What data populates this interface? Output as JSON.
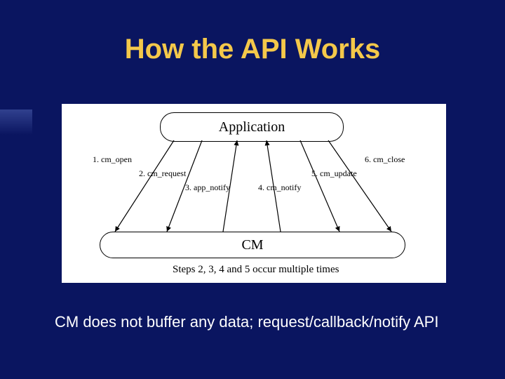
{
  "title": "How the API Works",
  "diagram": {
    "box_top": "Application",
    "box_bottom": "CM",
    "calls": {
      "c1": "1. cm_open",
      "c2": "2. cm_request",
      "c3": "3. app_notify",
      "c4": "4. cm_notify",
      "c5": "5. cm_update",
      "c6": "6. cm_close"
    },
    "caption": "Steps 2, 3, 4 and 5 occur multiple times"
  },
  "footer": "CM does not buffer any data; request/callback/notify API"
}
